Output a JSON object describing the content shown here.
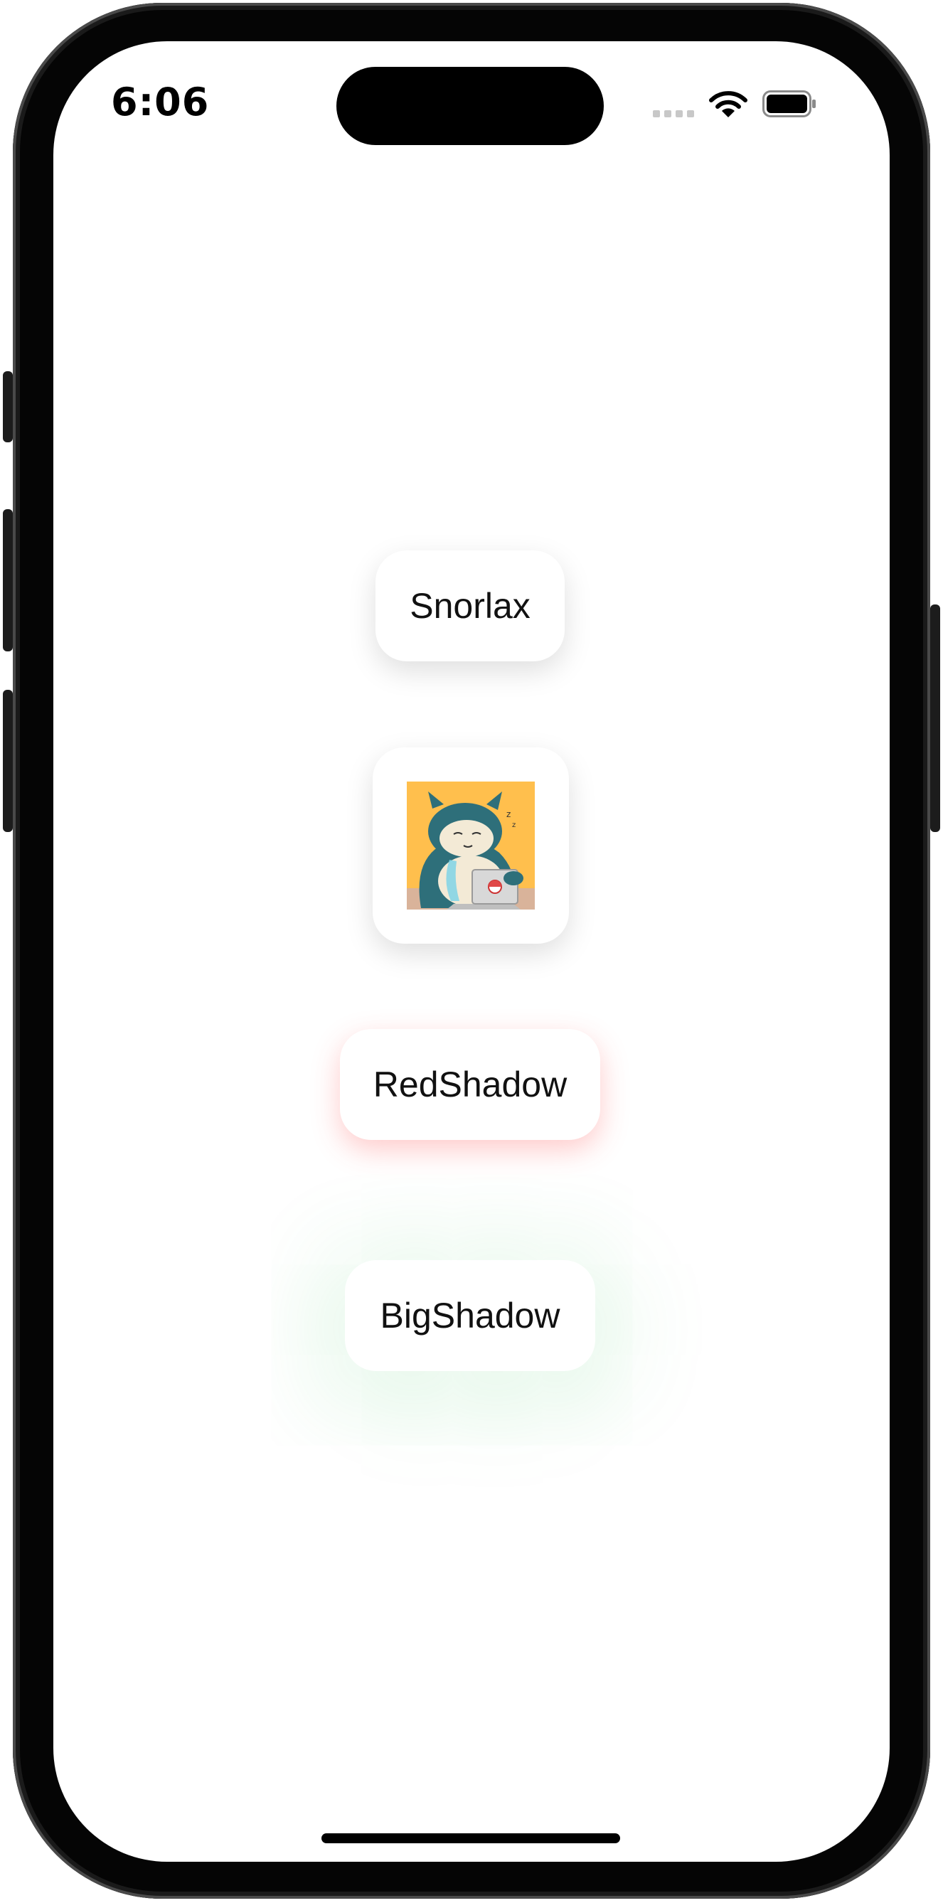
{
  "status_bar": {
    "time": "6:06",
    "signal_icon": "cellular-signal-icon",
    "wifi_icon": "wifi-icon",
    "battery_icon": "battery-icon"
  },
  "cards": {
    "snorlax_label": "Snorlax",
    "image_alt_icon": "snorlax-laptop-image",
    "red_shadow_label": "RedShadow",
    "big_shadow_label": "BigShadow"
  },
  "colors": {
    "red_shadow": "#ff4646",
    "big_shadow": "#3cc85a",
    "image_background": "#ffbf4d"
  }
}
